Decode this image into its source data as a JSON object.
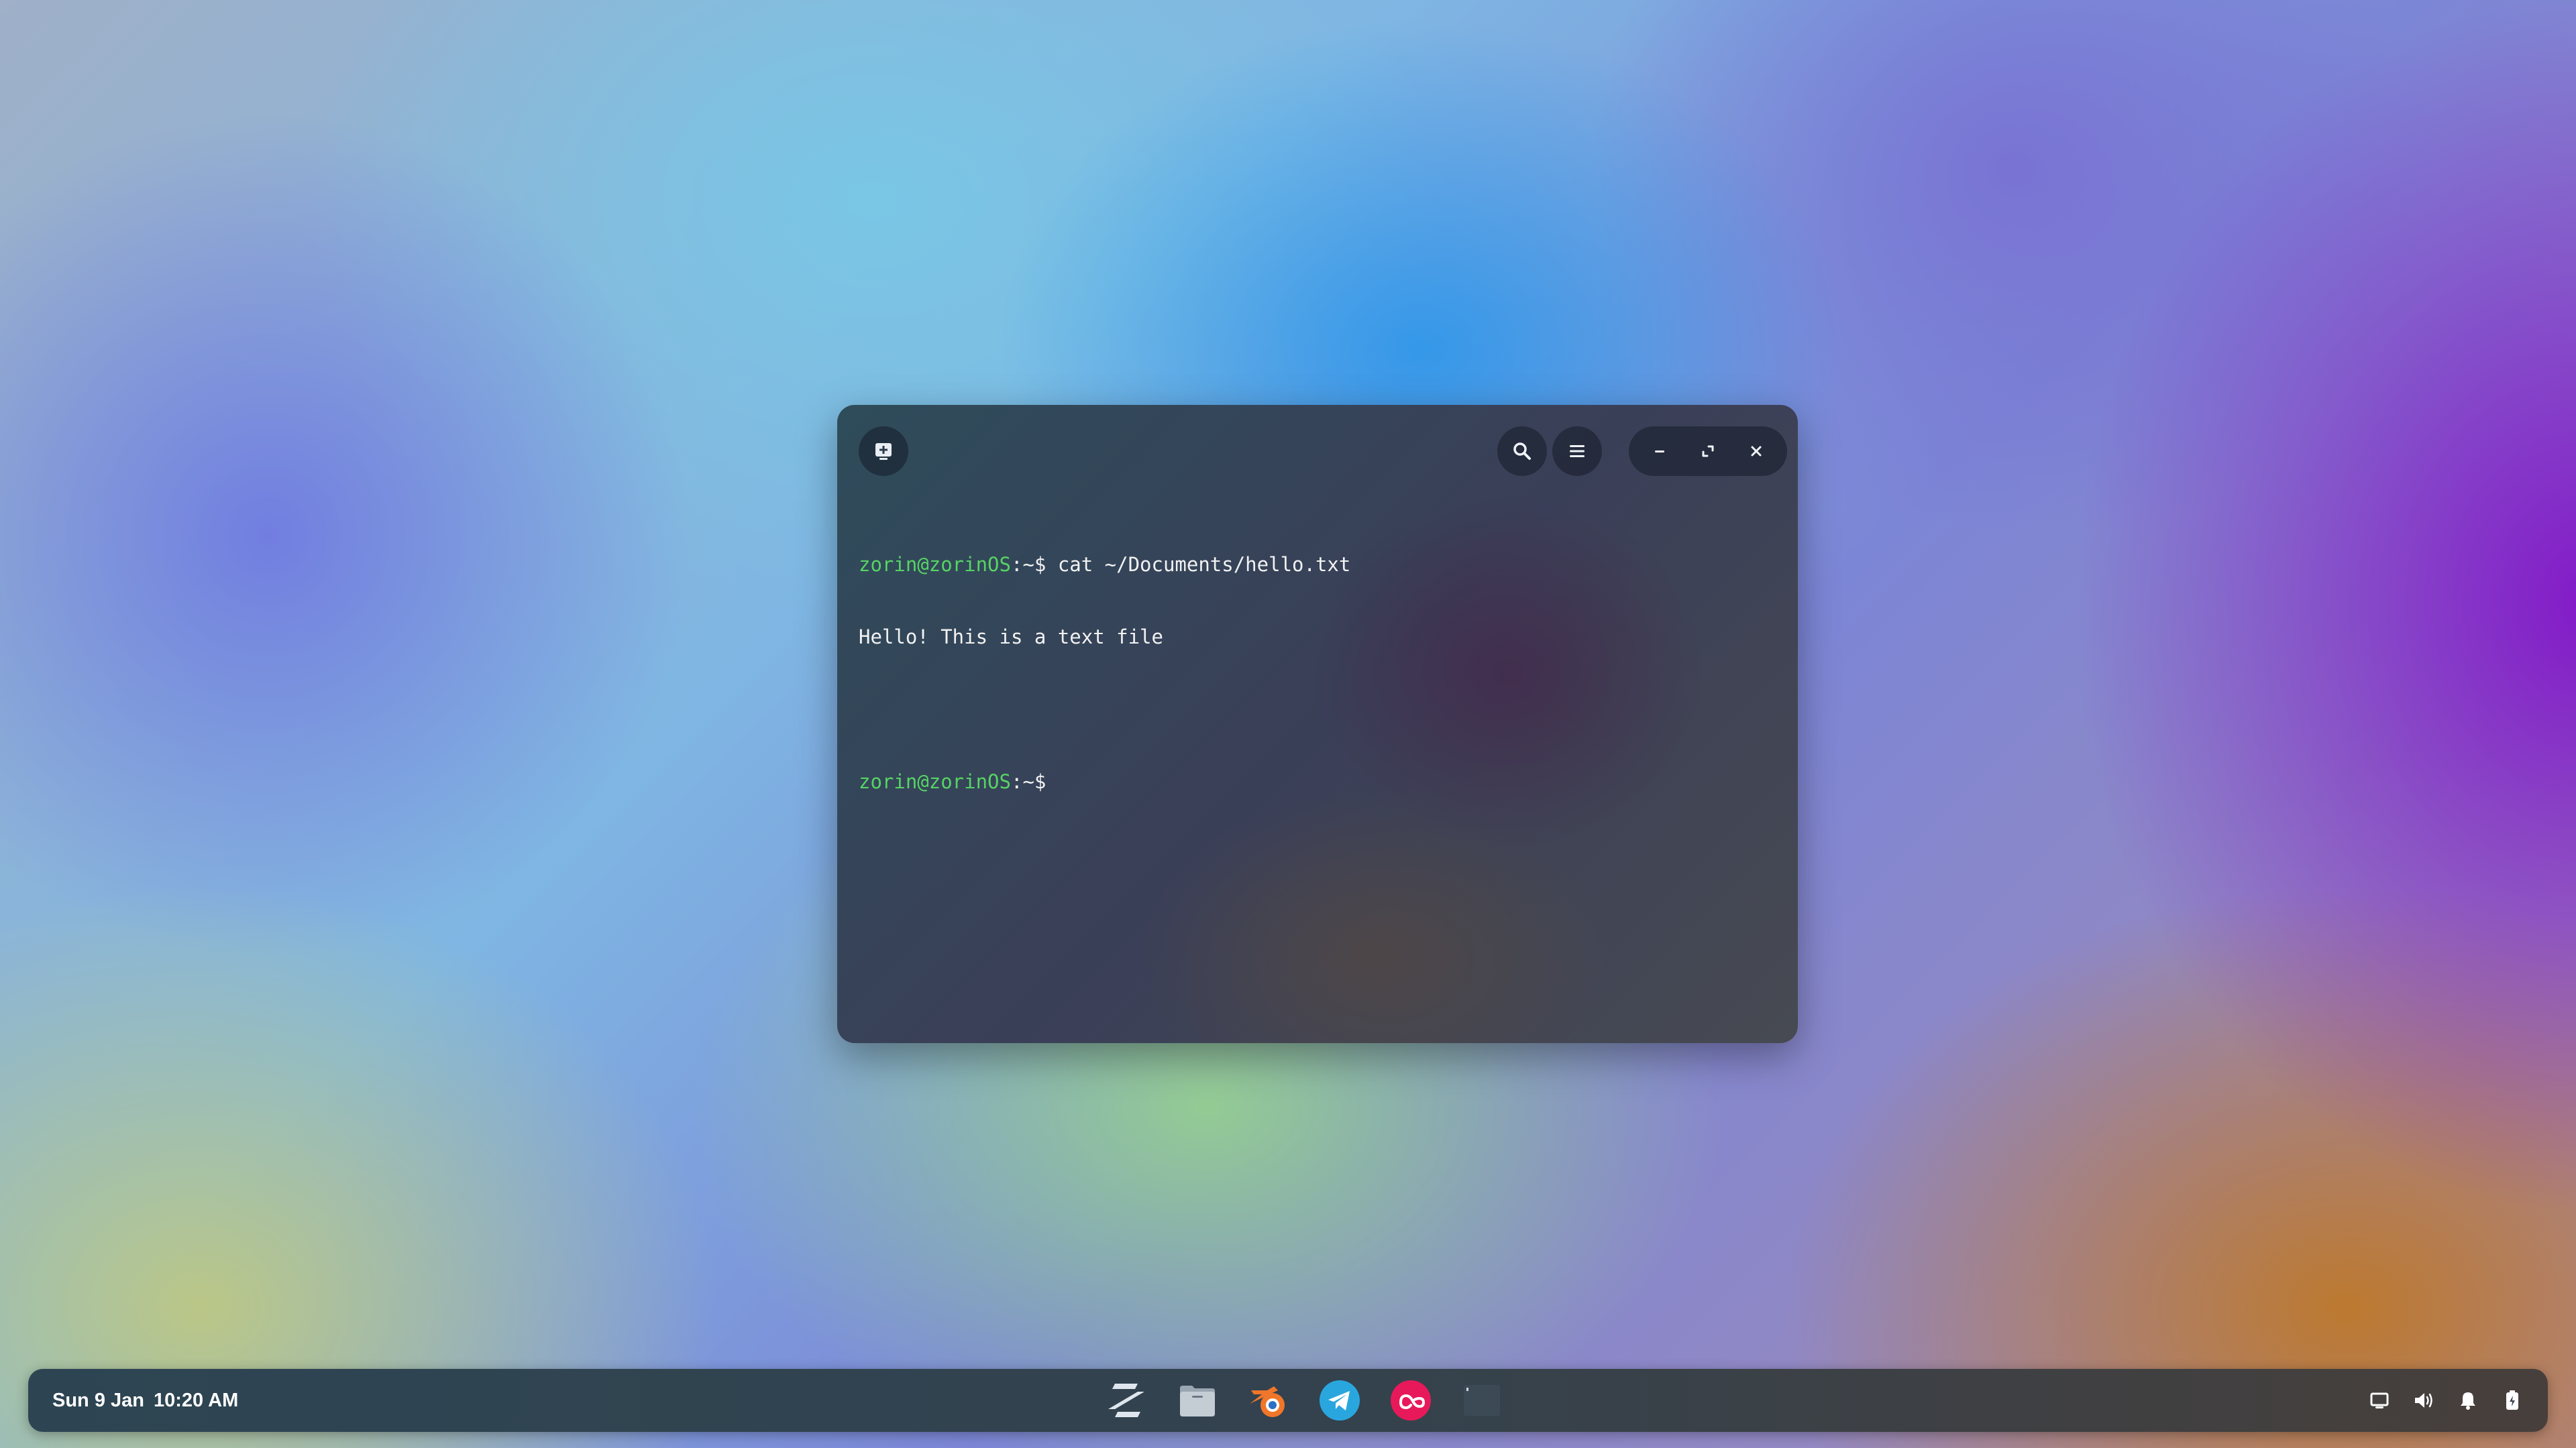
{
  "terminal": {
    "lines": [
      {
        "user": "zorin@zorinOS",
        "path": ":~$",
        "command": " cat ~/Documents/hello.txt"
      },
      {
        "output": "Hello! This is a text file"
      },
      {
        "output": ""
      },
      {
        "user": "zorin@zorinOS",
        "path": ":~$",
        "command": ""
      }
    ],
    "buttons": {
      "new_tab": "new-tab-icon",
      "search": "search-icon",
      "menu": "hamburger-menu-icon",
      "minimize": "minimize-icon",
      "maximize": "maximize-icon",
      "close": "close-icon"
    }
  },
  "taskbar": {
    "date": "Sun 9 Jan",
    "time": "10:20 AM",
    "dock": [
      {
        "name": "zorin-menu-icon",
        "color": "#dfe6ee"
      },
      {
        "name": "files-icon",
        "color": "#b8c2cc"
      },
      {
        "name": "blender-icon",
        "color": "#f0762a"
      },
      {
        "name": "telegram-icon",
        "color": "#2aa6df"
      },
      {
        "name": "creative-cloud-icon",
        "color": "#e8195a"
      },
      {
        "name": "terminal-icon",
        "color": "#3c4a55"
      }
    ],
    "tray": [
      "display-icon",
      "volume-icon",
      "notifications-icon",
      "battery-icon"
    ]
  },
  "colors": {
    "prompt_user": "#56d364",
    "text": "#f2f2f2"
  }
}
